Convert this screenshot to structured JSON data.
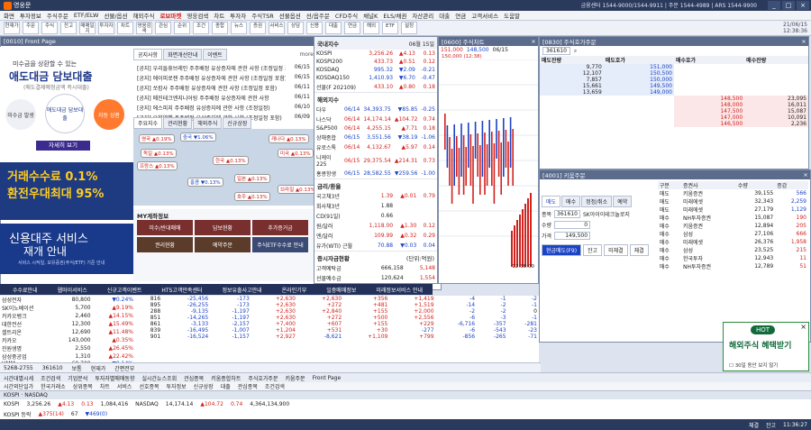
{
  "window": {
    "title": "영웅문",
    "info": "금융센터 1544-9000/1544-9911 | 주문 1544-4989 | ARS 1544-9900"
  },
  "menu": [
    "화면",
    "투자정보",
    "주식주문",
    "ETF/ELW",
    "선물/옵션",
    "해외주식",
    "로보마켓",
    "영웅검색",
    "차트",
    "투자자",
    "주식TSR",
    "선물옵션",
    "선/옵주문",
    "CFD주식",
    "채널K",
    "ELS/채권",
    "자산관리",
    "대출",
    "연금",
    "고객서비스",
    "도움말"
  ],
  "menu_hot": "로보마켓",
  "toolbar": [
    "현재가",
    "주문",
    "주식",
    "잔고",
    "매매일지",
    "투자자",
    "차트",
    "영웅검색",
    "관심",
    "순위",
    "조건",
    "종합",
    "뉴스",
    "증권",
    "서비스",
    "상담",
    "신용",
    "대출",
    "연금",
    "해외",
    "ETF",
    "설정"
  ],
  "clock": {
    "date": "21/06/15",
    "time": "12:38:36"
  },
  "front_page": {
    "title": "[0010] Front Page",
    "ad1": {
      "small": "미수금을 상환할 수 있는",
      "big": "애도대금 담보대출",
      "sub": "(매도결제예정금액 즉시대출)",
      "c1": "미수금 발생",
      "c2": "애도대금 담보대출",
      "c3": "자동 상환",
      "btn": "자세히 보기"
    },
    "ad2": {
      "l1": "거래수수료 0.1%",
      "l2": "환전우대최대 95%"
    },
    "ad3": {
      "l1": "신용대주 서비스",
      "l2": "재개 안내",
      "s": "서비스 시작일, 보유증권(주식/ETF) 기준 안내"
    },
    "notice_tabs": [
      "공지사항",
      "화면개선안내",
      "이벤트"
    ],
    "more": "more",
    "notices": [
      {
        "t": "[공지] 우리들휴브레인 주주배정 유상증자에 관한 사항 (조정일정 포",
        "d": "06/15"
      },
      {
        "t": "[공지] 에이피로젠 주주배정 유상증자에 관한 사항 (조정일정 포함)",
        "d": "06/15"
      },
      {
        "t": "[공지] 쏘캄사 주주배정 유상증자에 관한 사항 (조정일정 포함)",
        "d": "06/11"
      },
      {
        "t": "[공지] 메진테크엔지니어링 주주배정 유상증자에 관한 사항",
        "d": "06/11"
      },
      {
        "t": "[공지] 에스피지 주주배정 유상증자에 관한 사항 (조정일정)",
        "d": "06/10"
      },
      {
        "t": "[공지] 유한양행 주주배정 유상증자에 관한 사항 (조정일정 포함)",
        "d": "06/09"
      }
    ],
    "world_tabs": [
      "주요지수",
      "관리현황",
      "해외주식",
      "신규상장"
    ],
    "map_bubbles": [
      {
        "name": "영국",
        "val": "▲0.19%",
        "up": true
      },
      {
        "name": "독일",
        "val": "▲0.13%",
        "up": true
      },
      {
        "name": "프랑스",
        "val": "▲0.13%",
        "up": true
      },
      {
        "name": "중국",
        "val": "▼1.06%",
        "up": false
      },
      {
        "name": "한국",
        "val": "▲0.13%",
        "up": true
      },
      {
        "name": "홍콩",
        "val": "▼0.13%",
        "up": false
      },
      {
        "name": "일본",
        "val": "▲0.13%",
        "up": true
      },
      {
        "name": "캐나다",
        "val": "▲0.13%",
        "up": true
      },
      {
        "name": "미국",
        "val": "▲0.13%",
        "up": true
      },
      {
        "name": "호주",
        "val": "▲0.13%",
        "up": true
      },
      {
        "name": "브라질",
        "val": "▲0.13%",
        "up": true
      }
    ],
    "my_title": "MY계좌정보",
    "my_buttons": [
      "미수/반대매매",
      "담보현황",
      "추가증거금",
      "권리현황",
      "예약주문",
      "주식ETF수수료 안내"
    ],
    "banner": [
      "수수료안내",
      "웹마이서비스",
      "신규고객이벤트",
      "HTS고객만족센터",
      "정보유출사고안내",
      "온라인기부",
      "일중매매정보",
      "미래정보서비스 안내"
    ]
  },
  "index_panel": {
    "title": "국내지수",
    "date": "06월 15일",
    "domestic": [
      {
        "n": "KOSPI",
        "v": "3,256.26",
        "c": "▲4.13",
        "p": "0.13"
      },
      {
        "n": "KOSPI200",
        "v": "433.73",
        "c": "▲0.51",
        "p": "0.12"
      },
      {
        "n": "KOSDAQ",
        "v": "995.32",
        "c": "▼2.09",
        "p": "-0.21"
      },
      {
        "n": "KOSDAQ150",
        "v": "1,410.93",
        "c": "▼6.70",
        "p": "-0.47"
      },
      {
        "n": "선물(F 202109)",
        "v": "433.10",
        "c": "▲0.80",
        "p": "0.18"
      }
    ],
    "overseas_title": "해외지수",
    "overseas": [
      {
        "n": "다우",
        "d": "06/14",
        "v": "34,393.75",
        "c": "▼85.85",
        "p": "-0.25"
      },
      {
        "n": "나스닥",
        "d": "06/14",
        "v": "14,174.14",
        "c": "▲104.72",
        "p": "0.74"
      },
      {
        "n": "S&P500",
        "d": "06/14",
        "v": "4,255.15",
        "c": "▲7.71",
        "p": "0.18"
      },
      {
        "n": "상해종합",
        "d": "06/15",
        "v": "3,551.56",
        "c": "▼38.19",
        "p": "-1.06"
      },
      {
        "n": "유로스톡",
        "d": "06/14",
        "v": "4,132.67",
        "c": "▲5.97",
        "p": "0.14"
      },
      {
        "n": "니케이225",
        "d": "06/15",
        "v": "29,375.54",
        "c": "▲214.31",
        "p": "0.73"
      },
      {
        "n": "홍콩항생",
        "d": "06/15",
        "v": "28,582.55",
        "c": "▼259.56",
        "p": "-1.00"
      }
    ],
    "rates_title": "금리/환율",
    "rates": [
      {
        "n": "국고채3년",
        "v": "1.39",
        "c": "▲0.01",
        "p": "0.79"
      },
      {
        "n": "회사채3년",
        "v": "1.88",
        "c": "",
        "p": ""
      },
      {
        "n": "CD(91일)",
        "v": "0.66",
        "c": "",
        "p": ""
      },
      {
        "n": "원/달러",
        "v": "1,118.00",
        "c": "▲1.30",
        "p": "0.12"
      },
      {
        "n": "엔/달러",
        "v": "109.99",
        "c": "▲0.32",
        "p": "0.29"
      },
      {
        "n": "유가(WTI) 근월",
        "v": "70.88",
        "c": "▼0.03",
        "p": "0.04"
      }
    ],
    "fund_title": "증시자금현황",
    "fund_unit": "(단위:억원)",
    "funds": [
      {
        "n": "고객예탁금",
        "v": "666,158",
        "c": "5,148"
      },
      {
        "n": "선물예수금",
        "v": "120,624",
        "c": "1,554"
      },
      {
        "n": "미수금",
        "v": "3,116",
        "c": "433"
      },
      {
        "n": "신용잔고",
        "v": "235,640",
        "c": "987"
      }
    ]
  },
  "chart_win": {
    "title": "[0600] 주식차트",
    "price": "151,000",
    "vol": "148,500",
    "date": "06/15",
    "hi": "150,000 (12:38)",
    "time": "12:38:00"
  },
  "orderbook": {
    "title": "[0830] 주식호가주문",
    "code": "361610",
    "header": [
      "매도잔량",
      "매도호가",
      "매수호가",
      "매수잔량"
    ],
    "asks": [
      {
        "q": "9,770",
        "p": "151,000"
      },
      {
        "q": "12,107",
        "p": "150,500"
      },
      {
        "q": "7,857",
        "p": "150,000"
      },
      {
        "q": "15,661",
        "p": "149,500"
      },
      {
        "q": "13,659",
        "p": "149,000"
      }
    ],
    "bids": [
      {
        "p": "148,500",
        "q": "23,095"
      },
      {
        "p": "148,000",
        "q": "16,011"
      },
      {
        "p": "147,500",
        "q": "15,087"
      },
      {
        "p": "147,000",
        "q": "10,091"
      },
      {
        "p": "146,500",
        "q": "2,236"
      }
    ],
    "last": "149,500"
  },
  "order2": {
    "title": "[4001] 키움주문",
    "tabs": [
      "매도",
      "매수",
      "정정/취소",
      "예약"
    ],
    "account": "361610",
    "stock": "SK아이이테크놀로지",
    "price": "149,500",
    "qty": "0",
    "buttons": [
      "현금매도(F9)",
      "잔고",
      "미체결",
      "체결"
    ],
    "brokers_header": [
      "구분",
      "증권사",
      "수량",
      "증감"
    ],
    "brokers": [
      {
        "side": "매도",
        "name": "키움증권",
        "q": "39,155",
        "c": "566"
      },
      {
        "side": "매도",
        "name": "미래에셋",
        "q": "32,343",
        "c": "2,259"
      },
      {
        "side": "매도",
        "name": "미래에셋",
        "q": "27,179",
        "c": "1,129"
      },
      {
        "side": "매수",
        "name": "NH투자증권",
        "q": "15,087",
        "c": "190"
      },
      {
        "side": "매수",
        "name": "키움증권",
        "q": "12,894",
        "c": "205"
      },
      {
        "side": "매수",
        "name": "삼성",
        "q": "27,106",
        "c": "666"
      },
      {
        "side": "매수",
        "name": "미래에셋",
        "q": "26,376",
        "c": "1,958"
      },
      {
        "side": "매수",
        "name": "삼성",
        "q": "23,525",
        "c": "215"
      },
      {
        "side": "매수",
        "name": "한국투자",
        "q": "12,943",
        "c": "11"
      },
      {
        "side": "매수",
        "name": "NH투자증권",
        "q": "12,789",
        "c": "51"
      }
    ]
  },
  "left_list": [
    {
      "n": "삼성전자",
      "p": "80,800",
      "c": "▼0.24%"
    },
    {
      "n": "SK이노베이션",
      "p": "5,700",
      "c": "▲9.19%"
    },
    {
      "n": "카카오뱅크",
      "p": "2,460",
      "c": "▲14.15%"
    },
    {
      "n": "대한전선",
      "p": "12,300",
      "c": "▲15.49%"
    },
    {
      "n": "셀트리온",
      "p": "12,690",
      "c": "▲11.48%"
    },
    {
      "n": "카카오",
      "p": "143,000",
      "c": "▲0.35%"
    },
    {
      "n": "진원생명",
      "p": "2,550",
      "c": "▲26.45%"
    },
    {
      "n": "삼성중공업",
      "p": "1,310",
      "c": "▲22.42%"
    },
    {
      "n": "HMM",
      "p": "60,700",
      "c": "▼0.14%"
    }
  ],
  "lower": [
    [
      "816",
      "-25,456",
      "-173",
      "+2,630",
      "+2,630",
      "+356",
      "+1,419",
      "-4",
      "-1",
      "-2"
    ],
    [
      "895",
      "-26,255",
      "-173",
      "+2,630",
      "+272",
      "+481",
      "+1,519",
      "-14",
      "-2",
      "-1"
    ],
    [
      "288",
      "-9,135",
      "-1,197",
      "+2,630",
      "+2,840",
      "+155",
      "+2,000",
      "-2",
      "-2",
      "0"
    ],
    [
      "851",
      "-14,265",
      "-1,197",
      "+2,630",
      "+272",
      "+500",
      "+2,556",
      "-6",
      "-3",
      "-1"
    ],
    [
      "861",
      "-3,133",
      "-2,157",
      "+7,400",
      "+607",
      "+155",
      "+229",
      "-6,716",
      "-357",
      "-281"
    ],
    [
      "839",
      "-16,495",
      "-1,007",
      "+1,204",
      "+531",
      "+30",
      "-277",
      "-6",
      "-543",
      "-23"
    ],
    [
      "901",
      "-16,524",
      "-1,157",
      "+2,927",
      "-8,621",
      "+1,109",
      "+799",
      "-856",
      "-265",
      "-71"
    ]
  ],
  "bottom_controls": {
    "code": "5268-2755",
    "stock": "361610",
    "vol": "보통",
    "auto": "현재가",
    "mode": "간편전부"
  },
  "taskbar": [
    "시간대별시세",
    "조건검색",
    "기업분석",
    "투자자별매매동향",
    "실시간뉴스조회",
    "관심종목",
    "키움종합차트",
    "주식호가주문",
    "키움주문",
    "Front Page"
  ],
  "taskbar2": [
    "시간외단일가",
    "한국거래소",
    "상위종목",
    "차트",
    "서비스",
    "선호종목",
    "투자정보",
    "신규상장",
    "대출",
    "관심종목",
    "조건검색"
  ],
  "tickers": [
    {
      "n": "KOSPI",
      "v": "3,256.26",
      "c": "▲4.13",
      "p": "0.13",
      "vol": "1,084,416"
    },
    {
      "n": "NASDAQ",
      "v": "14,174.14",
      "c": "▲104.72",
      "p": "0.74",
      "vol": "4,364,134,900"
    }
  ],
  "tickers2": [
    {
      "n": "KOSPI 등락",
      "v": "▲375(14)",
      "c": "67",
      "p": "▼469(0)"
    }
  ],
  "status": [
    "체결",
    "잔고",
    "11:36:27"
  ],
  "hot_ad": {
    "badge": "HOT",
    "text": "해외주식 혜택받기",
    "cb": "30일 동안 보지 않기"
  },
  "colors": {
    "up": "#d1221e",
    "down": "#1b43c5",
    "brand": "#2a3a5c",
    "accent": "#ff6a00"
  }
}
